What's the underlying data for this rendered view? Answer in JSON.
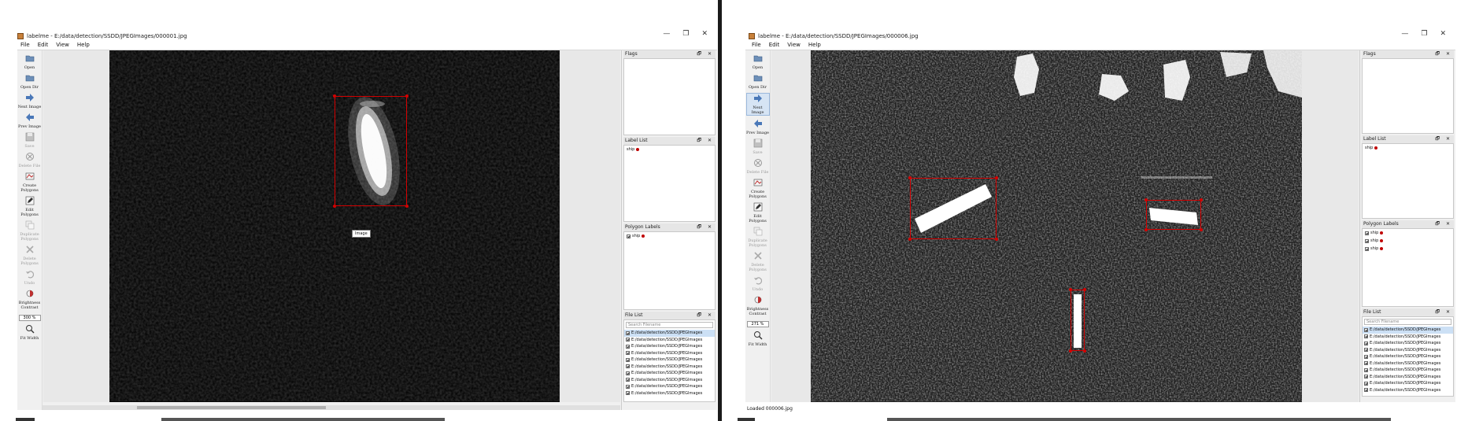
{
  "left": {
    "title": "labelme - E:/data/detection/SSDD/JPEGImages/000001.jpg",
    "menu": [
      "File",
      "Edit",
      "View",
      "Help"
    ],
    "zoom": "300 %",
    "tooltip": "Image",
    "label_list": [
      {
        "label": "ship"
      }
    ],
    "polygon_labels": [
      {
        "label": "ship"
      }
    ],
    "search_placeholder": "Search Filename",
    "files": [
      "E:/data/detection/SSDD/JPEGImages",
      "E:/data/detection/SSDD/JPEGImages",
      "E:/data/detection/SSDD/JPEGImages",
      "E:/data/detection/SSDD/JPEGImages",
      "E:/data/detection/SSDD/JPEGImages",
      "E:/data/detection/SSDD/JPEGImages",
      "E:/data/detection/SSDD/JPEGImages",
      "E:/data/detection/SSDD/JPEGImages",
      "E:/data/detection/SSDD/JPEGImages",
      "E:/data/detection/SSDD/JPEGImages"
    ]
  },
  "right": {
    "title": "labelme - E:/data/detection/SSDD/JPEGImages/000006.jpg",
    "menu": [
      "File",
      "Edit",
      "View",
      "Help"
    ],
    "zoom": "271 %",
    "status": "Loaded 000006.jpg",
    "label_list": [
      {
        "label": "ship"
      }
    ],
    "polygon_labels": [
      {
        "label": "ship"
      },
      {
        "label": "ship"
      },
      {
        "label": "ship"
      }
    ],
    "search_placeholder": "Search Filename",
    "files": [
      "E:/data/detection/SSDD/JPEGImages",
      "E:/data/detection/SSDD/JPEGImages",
      "E:/data/detection/SSDD/JPEGImages",
      "E:/data/detection/SSDD/JPEGImages",
      "E:/data/detection/SSDD/JPEGImages",
      "E:/data/detection/SSDD/JPEGImages",
      "E:/data/detection/SSDD/JPEGImages",
      "E:/data/detection/SSDD/JPEGImages",
      "E:/data/detection/SSDD/JPEGImages",
      "E:/data/detection/SSDD/JPEGImages"
    ]
  },
  "window_controls": [
    "—",
    "❐",
    "✕"
  ],
  "dock_titles": {
    "flags": "Flags",
    "label_list": "Label List",
    "polygon_labels": "Polygon Labels",
    "file_list": "File List"
  },
  "dock_buttons": "🗗 ✕",
  "tools": [
    {
      "id": "open",
      "label": "Open",
      "icon": "folder-open-icon"
    },
    {
      "id": "open-dir",
      "label": "Open Dir",
      "icon": "folder-open-icon"
    },
    {
      "id": "next-image",
      "label": "Next Image",
      "icon": "arrow-right-icon"
    },
    {
      "id": "prev-image",
      "label": "Prev Image",
      "icon": "arrow-left-icon"
    },
    {
      "id": "save",
      "label": "Save",
      "icon": "save-icon"
    },
    {
      "id": "delete-file",
      "label": "Delete File",
      "icon": "delete-icon"
    },
    {
      "id": "create-polygons",
      "label": "Create Polygons",
      "icon": "polygon-icon"
    },
    {
      "id": "edit-polygons",
      "label": "Edit Polygons",
      "icon": "edit-icon"
    },
    {
      "id": "duplicate-polygons",
      "label": "Duplicate Polygons",
      "icon": "copy-icon"
    },
    {
      "id": "delete-polygons",
      "label": "Delete Polygons",
      "icon": "cross-icon"
    },
    {
      "id": "undo",
      "label": "Undo",
      "icon": "undo-icon"
    },
    {
      "id": "brightness-contrast",
      "label": "Brightness Contrast",
      "icon": "brightness-icon"
    }
  ],
  "fit_width_label": "Fit Width",
  "colors": {
    "box": "#d40000",
    "label_dot": "#c00000"
  }
}
